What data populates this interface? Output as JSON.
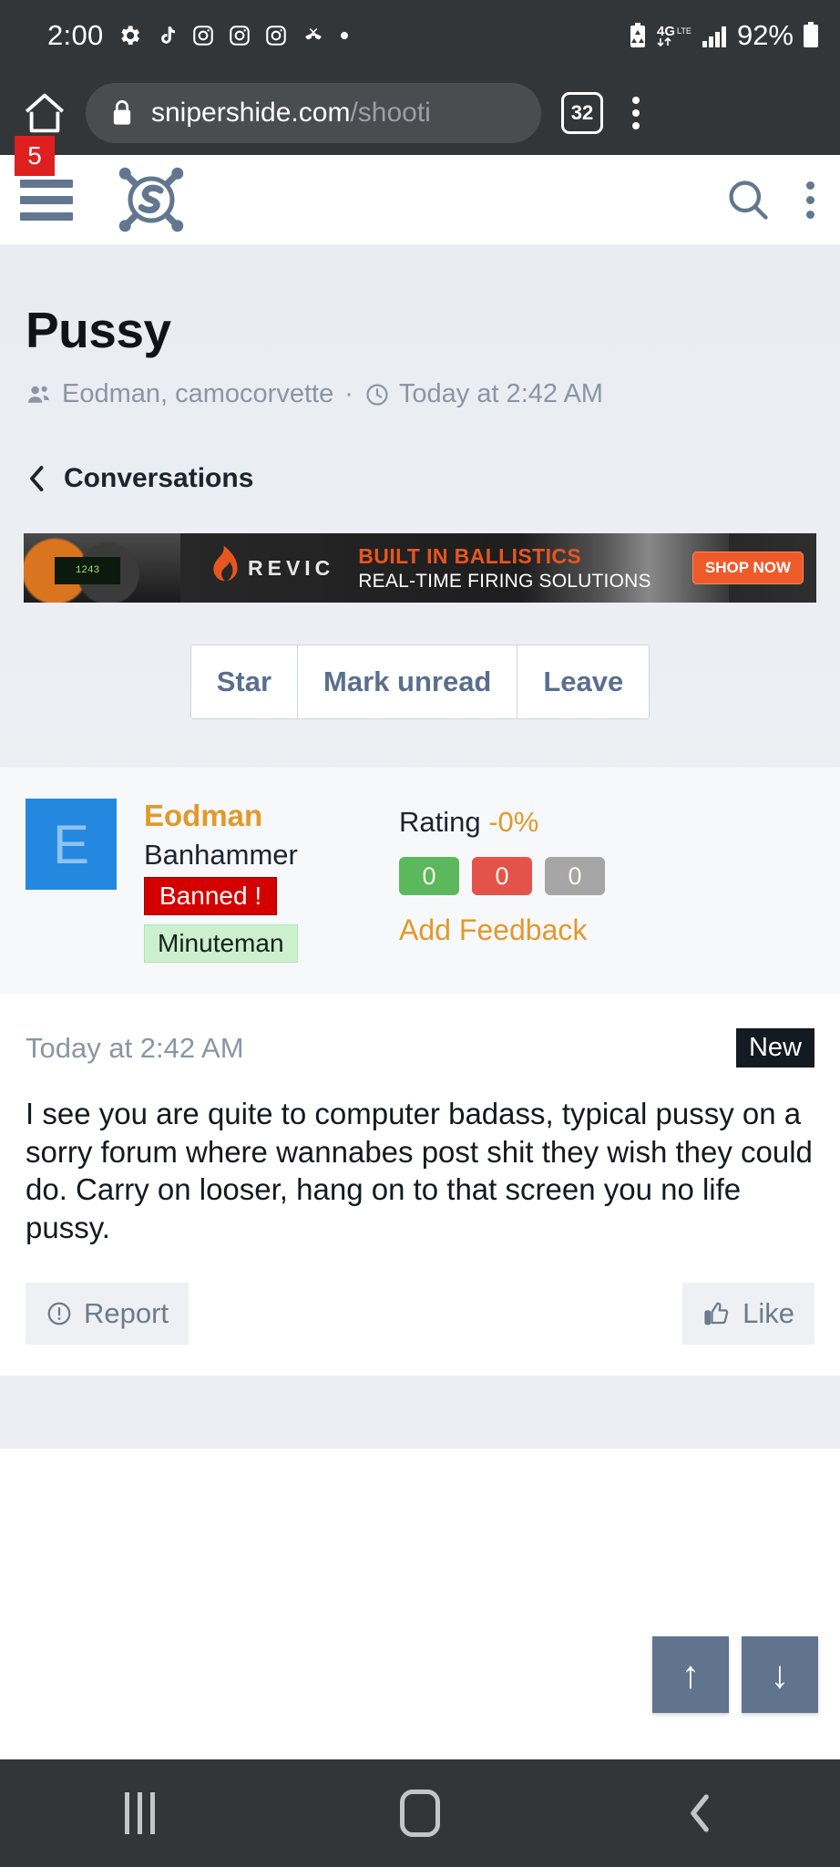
{
  "statusbar": {
    "clock": "2:00",
    "left_icons": [
      "settings-gear-icon",
      "tiktok-icon",
      "instagram-icon",
      "instagram-icon",
      "instagram-icon",
      "missed-call-icon",
      "dot-icon"
    ],
    "battery_percent": "92%",
    "network": "4G",
    "right_icons": [
      "battery-saver-icon",
      "4g-data-icon",
      "signal-bars-icon",
      "battery-icon"
    ]
  },
  "browser": {
    "home_icon": "home-icon",
    "lock_icon": "lock-icon",
    "url_domain": "snipershide.com",
    "url_path": "/shooti",
    "tab_count": "32",
    "menu_icon": "kebab-menu-icon"
  },
  "site_header": {
    "menu_badge": "5",
    "hamburger_icon": "hamburger-menu-icon",
    "logo_icon": "snipers-hide-logo-icon",
    "search_icon": "search-icon",
    "overflow_icon": "kebab-menu-icon"
  },
  "thread": {
    "title": "Pussy",
    "participants_icon": "people-icon",
    "participants": "Eodman, camocorvette",
    "separator": "·",
    "clock_icon": "clock-icon",
    "timestamp": "Today at 2:42 AM",
    "breadcrumb_icon": "chevron-left-icon",
    "breadcrumb_label": "Conversations"
  },
  "ad": {
    "brand": "REVIC",
    "flame_icon": "flame-icon",
    "headline": "BUILT IN BALLISTICS",
    "subhead": "REAL-TIME FIRING SOLUTIONS",
    "cta": "SHOP NOW",
    "lcd_text": "1243"
  },
  "actions": {
    "star": "Star",
    "mark_unread": "Mark unread",
    "leave": "Leave"
  },
  "author": {
    "avatar_letter": "E",
    "avatar_color": "#2488e0",
    "username": "Eodman",
    "username_color": "#e09a2c",
    "title": "Banhammer",
    "banned_badge": "Banned !",
    "banned_color": "#d40000",
    "rank_badge": "Minuteman",
    "rank_color": "#ccf0cd",
    "rating_label": "Rating ",
    "rating_value": "-0%",
    "positive_count": "0",
    "negative_count": "0",
    "neutral_count": "0",
    "add_feedback": "Add Feedback"
  },
  "message": {
    "date": "Today at 2:42 AM",
    "new_badge": "New",
    "body": "I see you are quite to computer badass, typical pussy on a sorry forum where wannabes post shit they wish\nthey could do. Carry on looser, hang on to that screen you no life pussy.",
    "report_icon": "alert-circle-icon",
    "report_label": "Report",
    "like_icon": "thumbs-up-icon",
    "like_label": "Like"
  },
  "scroll_fabs": {
    "up_icon": "arrow-up-icon",
    "up_label": "↑",
    "down_icon": "arrow-down-icon",
    "down_label": "↓"
  },
  "navbar": {
    "recents_icon": "recents-icon",
    "home_icon": "home-square-icon",
    "back_icon": "back-chevron-icon",
    "back_label": "‹"
  }
}
